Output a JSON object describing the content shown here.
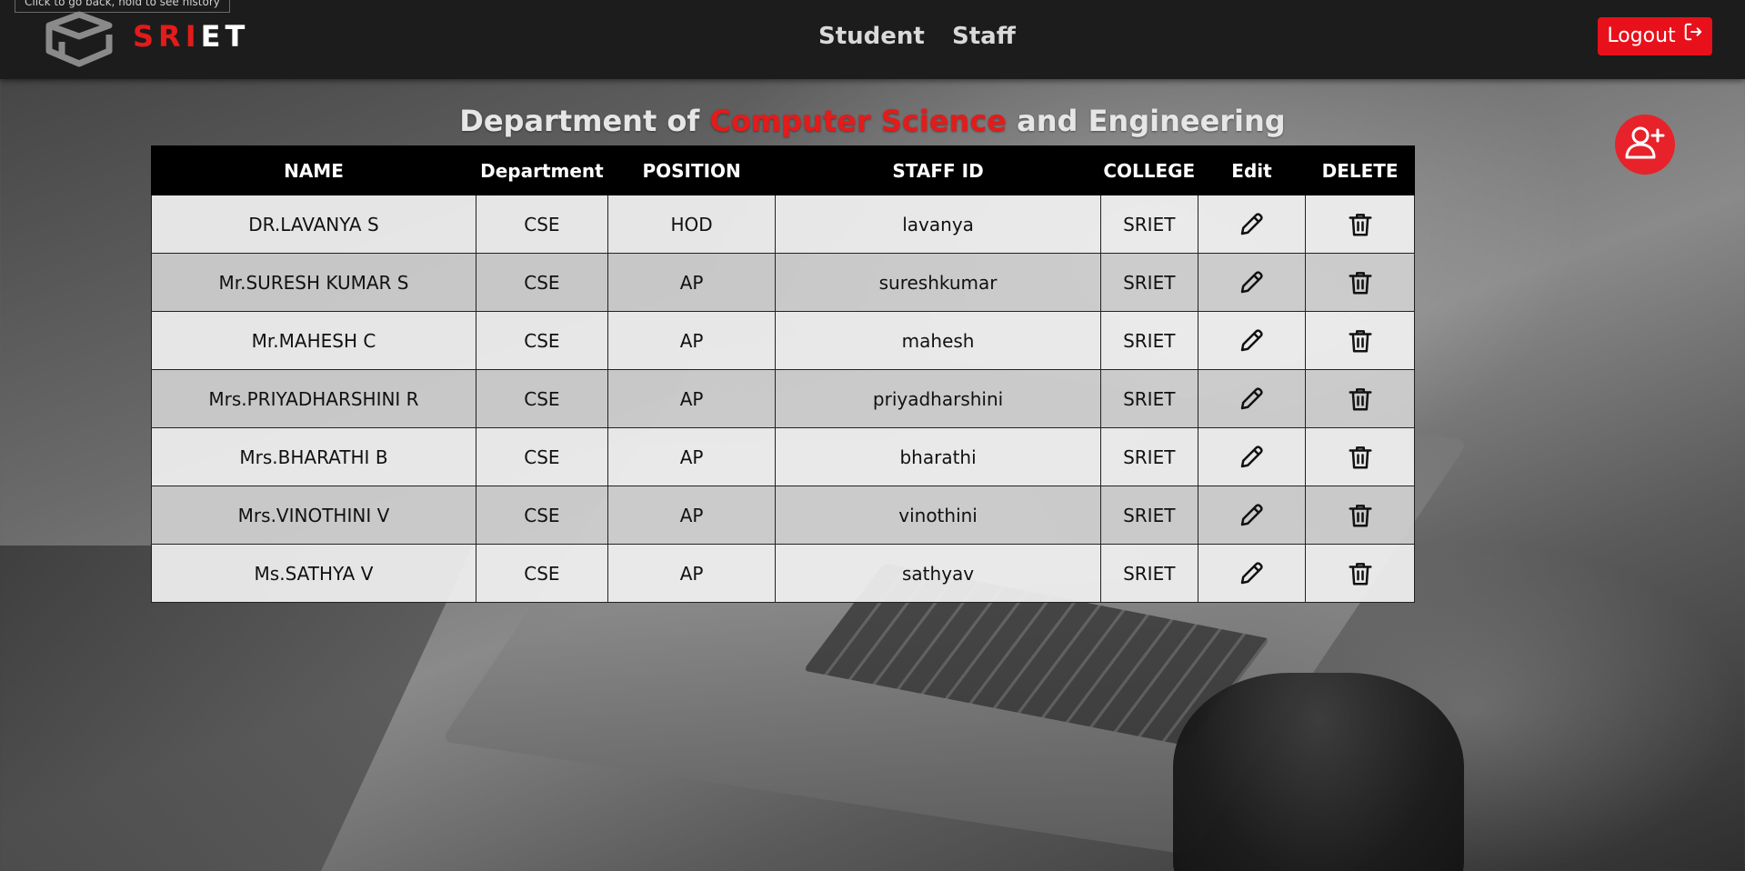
{
  "tooltip": "Click to go back, hold to see history",
  "brand": {
    "part_red": "SRI",
    "part_white": "ET"
  },
  "nav": {
    "student": "Student",
    "staff": "Staff"
  },
  "logout": {
    "label": "Logout",
    "icon": "logout-icon"
  },
  "title": {
    "prefix": "Department of",
    "accent": "Computer Science",
    "suffix": "and Engineering"
  },
  "add_user_icon": "add-user-icon",
  "colors": {
    "accent": "#e31b1b",
    "header_bg": "#1c1c1c",
    "table_header_bg": "#000000"
  },
  "table": {
    "headers": [
      "NAME",
      "Department",
      "POSITION",
      "STAFF ID",
      "COLLEGE",
      "Edit",
      "DELETE"
    ],
    "rows": [
      {
        "name": "DR.LAVANYA S",
        "department": "CSE",
        "position": "HOD",
        "staff_id": "lavanya",
        "college": "SRIET"
      },
      {
        "name": "Mr.SURESH KUMAR S",
        "department": "CSE",
        "position": "AP",
        "staff_id": "sureshkumar",
        "college": "SRIET"
      },
      {
        "name": "Mr.MAHESH C",
        "department": "CSE",
        "position": "AP",
        "staff_id": "mahesh",
        "college": "SRIET"
      },
      {
        "name": "Mrs.PRIYADHARSHINI R",
        "department": "CSE",
        "position": "AP",
        "staff_id": "priyadharshini",
        "college": "SRIET"
      },
      {
        "name": "Mrs.BHARATHI B",
        "department": "CSE",
        "position": "AP",
        "staff_id": "bharathi",
        "college": "SRIET"
      },
      {
        "name": "Mrs.VINOTHINI V",
        "department": "CSE",
        "position": "AP",
        "staff_id": "vinothini",
        "college": "SRIET"
      },
      {
        "name": "Ms.SATHYA V",
        "department": "CSE",
        "position": "AP",
        "staff_id": "sathyav",
        "college": "SRIET"
      }
    ],
    "edit_icon": "pencil-icon",
    "delete_icon": "trash-icon"
  }
}
